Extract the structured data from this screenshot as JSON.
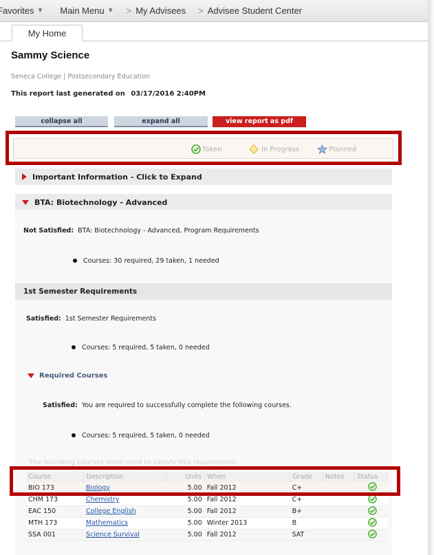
{
  "nav": {
    "favorites": "Favorites",
    "main_menu": "Main Menu",
    "sep": ">",
    "my_advisees": "My Advisees",
    "advisee_student_center": "Advisee Student Center"
  },
  "tab": {
    "my_home": "My Home"
  },
  "student": {
    "name": "Sammy Science",
    "institution": "Seneca College | Postsecondary Education",
    "report_label": "This report last generated on",
    "report_date": "03/17/2016 2:40PM"
  },
  "buttons": {
    "collapse_all": "collapse all",
    "expand_all": "expand all",
    "view_pdf": "view report as pdf"
  },
  "legend": {
    "taken": "Taken",
    "in_progress": "In Progress",
    "planned": "Planned",
    "colors": {
      "taken": "#4caf3a",
      "in_progress": "#e8b830",
      "planned": "#5a7ab8"
    }
  },
  "sections": {
    "important_info": "Important Information - Click to Expand",
    "bta_title": "BTA: Biotechnology - Advanced",
    "not_satisfied_label": "Not Satisfied:",
    "not_satisfied_text": "BTA: Biotechnology - Advanced, Program Requirements",
    "courses_needed": "Courses: 30 required, 29 taken, 1 needed",
    "semester_title": "1st Semester Requirements",
    "satisfied_label": "Satisfied:",
    "semester_satisfied_text": "1st Semester Requirements",
    "semester_courses": "Courses: 5 required, 5 taken, 0 needed",
    "required_courses": "Required Courses",
    "required_satisfied_label": "Satisfied:",
    "required_satisfied_text": "You are required to successfully complete the following courses.",
    "required_courses_count": "Courses: 5 required, 5 taken, 0 needed",
    "used_to_satisfy": "The following courses were used to satisfy this requirement:"
  },
  "table": {
    "headers": [
      "Course",
      "Description",
      "Units",
      "When",
      "Grade",
      "Notes",
      "Status"
    ],
    "rows": [
      {
        "course": "BIO 173",
        "description": "Biology",
        "units": "5.00",
        "when": "Fall 2012",
        "grade": "C+",
        "notes": "",
        "status": "taken"
      },
      {
        "course": "CHM 173",
        "description": "Chemistry",
        "units": "5.00",
        "when": "Fall 2012",
        "grade": "C+",
        "notes": "",
        "status": "taken"
      },
      {
        "course": "EAC 150",
        "description": "College English",
        "units": "5.00",
        "when": "Fall 2012",
        "grade": "B+",
        "notes": "",
        "status": "taken"
      },
      {
        "course": "MTH 173",
        "description": "Mathematics",
        "units": "5.00",
        "when": "Winter 2013",
        "grade": "B",
        "notes": "",
        "status": "taken"
      },
      {
        "course": "SSA 001",
        "description": "Science Survival",
        "units": "5.00",
        "when": "Fall 2012",
        "grade": "SAT",
        "notes": "",
        "status": "taken"
      }
    ]
  },
  "accent": {
    "red": "#b30000",
    "button_red": "#cc1f1f",
    "link": "#2255aa"
  }
}
